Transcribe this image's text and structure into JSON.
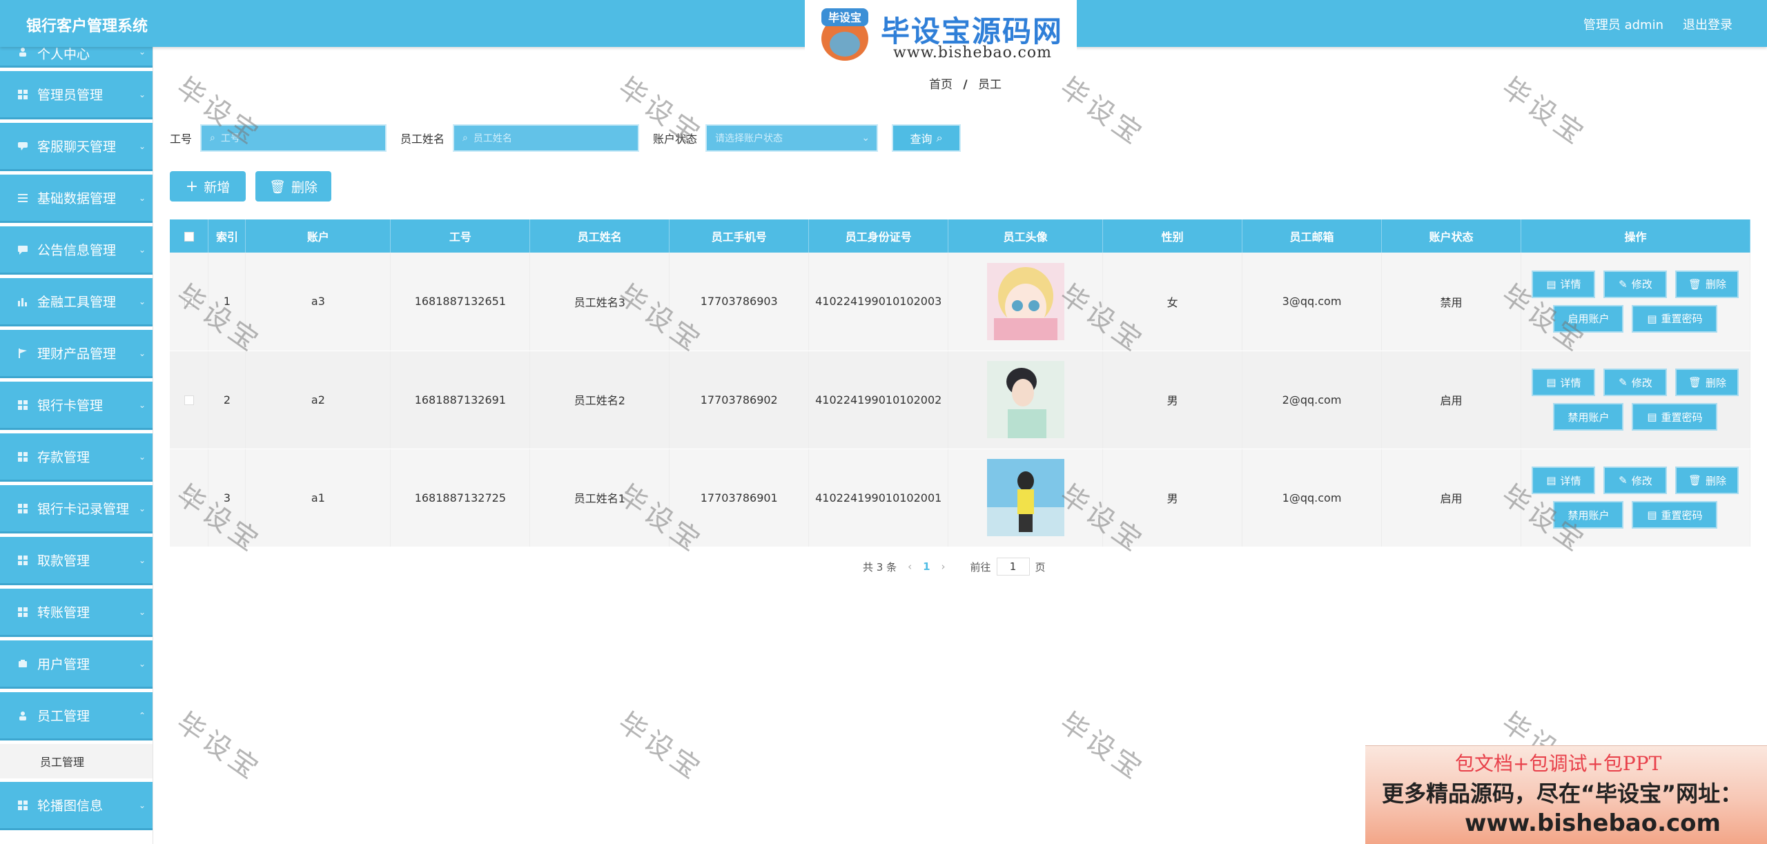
{
  "header": {
    "app_title": "银行客户管理系统",
    "user": "管理员 admin",
    "logout": "退出登录"
  },
  "logo": {
    "badge": "毕设宝",
    "title": "毕设宝源码网",
    "url": "www.bishebao.com"
  },
  "sidebar": {
    "items": [
      {
        "label": "个人中心",
        "icon": "user-icon"
      },
      {
        "label": "管理员管理",
        "icon": "grid-icon"
      },
      {
        "label": "客服聊天管理",
        "icon": "chat-icon"
      },
      {
        "label": "基础数据管理",
        "icon": "list-icon"
      },
      {
        "label": "公告信息管理",
        "icon": "message-icon"
      },
      {
        "label": "金融工具管理",
        "icon": "bar-chart-icon"
      },
      {
        "label": "理财产品管理",
        "icon": "flag-icon"
      },
      {
        "label": "银行卡管理",
        "icon": "grid-icon"
      },
      {
        "label": "存款管理",
        "icon": "grid-icon"
      },
      {
        "label": "银行卡记录管理",
        "icon": "grid-icon"
      },
      {
        "label": "取款管理",
        "icon": "grid-icon"
      },
      {
        "label": "转账管理",
        "icon": "grid-icon"
      },
      {
        "label": "用户管理",
        "icon": "users-icon"
      },
      {
        "label": "员工管理",
        "icon": "user-icon"
      }
    ],
    "sub_item": "员工管理",
    "last_item": {
      "label": "轮播图信息",
      "icon": "grid-icon"
    }
  },
  "breadcrumb": {
    "home": "首页",
    "sep": "/",
    "current": "员工"
  },
  "search": {
    "field1_label": "工号",
    "field1_placeholder": "工号",
    "field2_label": "员工姓名",
    "field2_placeholder": "员工姓名",
    "field3_label": "账户状态",
    "field3_placeholder": "请选择账户状态",
    "query": "查询"
  },
  "actions": {
    "add": "新增",
    "delete": "删除"
  },
  "table": {
    "headers": [
      "索引",
      "账户",
      "工号",
      "员工姓名",
      "员工手机号",
      "员工身份证号",
      "员工头像",
      "性别",
      "员工邮箱",
      "账户状态",
      "操作"
    ],
    "rows": [
      {
        "index": "1",
        "account": "a3",
        "job_no": "1681887132651",
        "name": "员工姓名3",
        "phone": "17703786903",
        "id_card": "410224199010102003",
        "gender": "女",
        "email": "3@qq.com",
        "status": "禁用",
        "toggle": "启用账户"
      },
      {
        "index": "2",
        "account": "a2",
        "job_no": "1681887132691",
        "name": "员工姓名2",
        "phone": "17703786902",
        "id_card": "410224199010102002",
        "gender": "男",
        "email": "2@qq.com",
        "status": "启用",
        "toggle": "禁用账户"
      },
      {
        "index": "3",
        "account": "a1",
        "job_no": "1681887132725",
        "name": "员工姓名1",
        "phone": "17703786901",
        "id_card": "410224199010102001",
        "gender": "男",
        "email": "1@qq.com",
        "status": "启用",
        "toggle": "禁用账户"
      }
    ],
    "op_detail": "详情",
    "op_edit": "修改",
    "op_delete": "删除",
    "op_reset": "重置密码"
  },
  "pager": {
    "total": "共 3 条",
    "current_page": "1",
    "goto": "前往",
    "page_input": "1",
    "page_suffix": "页"
  },
  "watermark": "毕设宝",
  "promo": {
    "line1": "包文档+包调试+包PPT",
    "line2": "更多精品源码，尽在“毕设宝”网址：",
    "line3": "www.bishebao.com"
  }
}
